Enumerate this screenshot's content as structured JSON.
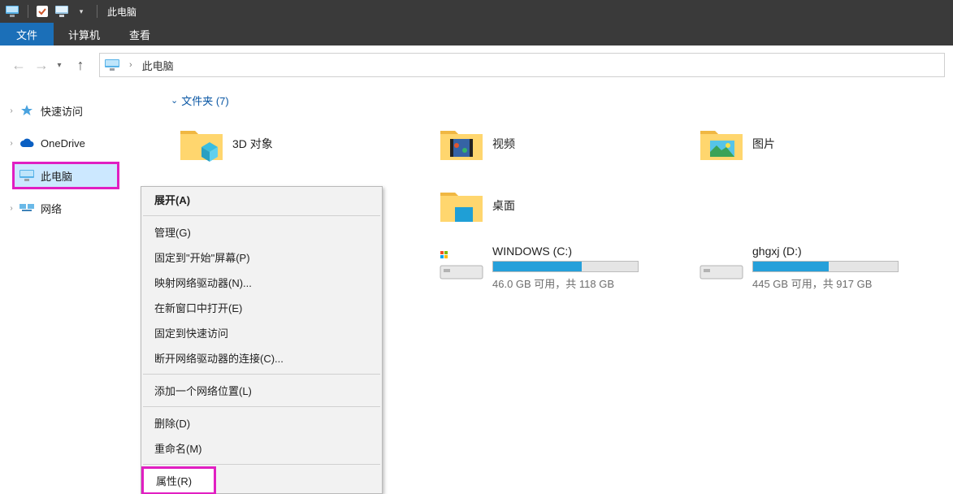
{
  "titlebar": {
    "title": "此电脑"
  },
  "ribbon": {
    "file": "文件",
    "tabs": [
      "计算机",
      "查看"
    ]
  },
  "nav": {
    "crumb": "此电脑"
  },
  "tree": {
    "items": [
      {
        "label": "快速访问"
      },
      {
        "label": "OneDrive"
      },
      {
        "label": "此电脑"
      },
      {
        "label": "网络"
      }
    ]
  },
  "content": {
    "folders_header": "文件夹 (7)",
    "folders": [
      {
        "label": "3D 对象"
      },
      {
        "label": "视频"
      },
      {
        "label": "图片"
      },
      {
        "label": "桌面"
      }
    ],
    "drives": [
      {
        "name": "WINDOWS (C:)",
        "free_text": "46.0 GB 可用，共 118 GB",
        "fill_pct": 61
      },
      {
        "name": "ghgxj (D:)",
        "free_text": "445 GB 可用，共 917 GB",
        "fill_pct": 52
      }
    ]
  },
  "context_menu": {
    "items": [
      "展开(A)",
      "管理(G)",
      "固定到\"开始\"屏幕(P)",
      "映射网络驱动器(N)...",
      "在新窗口中打开(E)",
      "固定到快速访问",
      "断开网络驱动器的连接(C)...",
      "添加一个网络位置(L)",
      "删除(D)",
      "重命名(M)",
      "属性(R)"
    ]
  }
}
